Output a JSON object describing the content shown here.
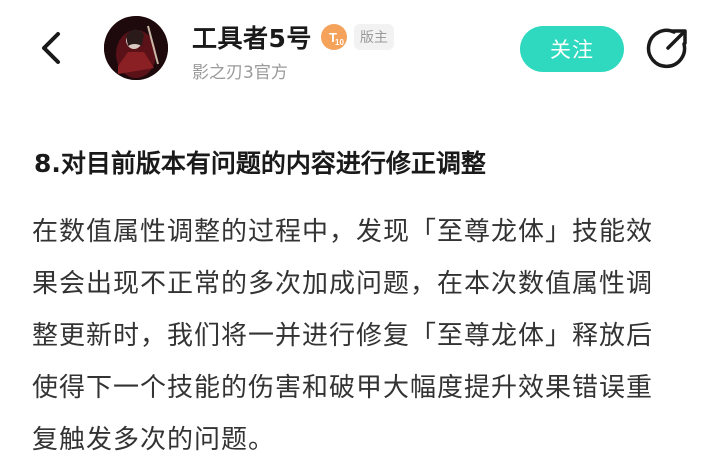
{
  "header": {
    "username": "工具者5号",
    "level_badge": "10",
    "role_badge": "版主",
    "subtitle": "影之刃3官方",
    "follow_label": "关注",
    "icons": {
      "back": "chevron-left-icon",
      "share": "share-icon"
    },
    "colors": {
      "follow_bg": "#2fd9bf",
      "level_badge": "#f5a25a"
    }
  },
  "post": {
    "heading": "8.对目前版本有问题的内容进行修正调整",
    "body": "在数值属性调整的过程中，发现「至尊龙体」技能效果会出现不正常的多次加成问题，在本次数值属性调整更新时，我们将一并进行修复「至尊龙体」释放后使得下一个技能的伤害和破甲大幅度提升效果错误重复触发多次的问题。"
  }
}
